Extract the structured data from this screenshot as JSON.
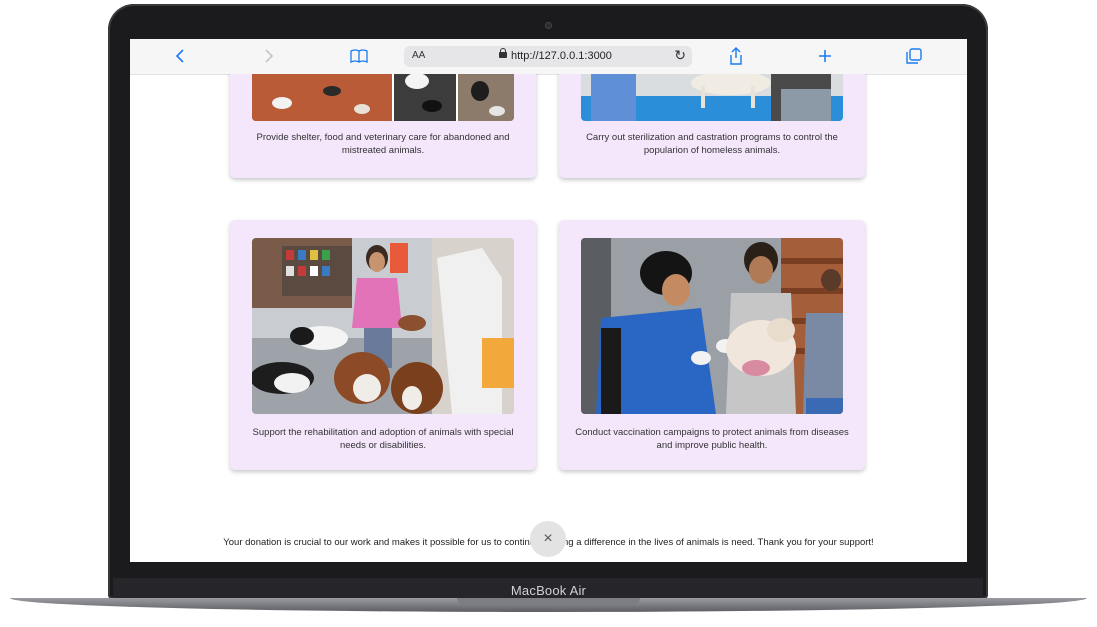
{
  "device": {
    "label": "MacBook Air"
  },
  "browser": {
    "text_size_label": "AA",
    "url": "http://127.0.0.1:3000",
    "icons": [
      "back-icon",
      "forward-icon",
      "reader-icon",
      "lock-icon",
      "reload-icon",
      "share-icon",
      "new-tab-icon",
      "tabs-icon"
    ]
  },
  "cards": [
    {
      "caption": "Provide shelter, food and veterinary care for abandoned and mistreated animals."
    },
    {
      "caption": "Carry out sterilization and castration programs to control the popularion of homeless animals."
    },
    {
      "caption": "Support the rehabilitation and adoption of animals with special needs or disabilities."
    },
    {
      "caption": "Conduct vaccination campaigns to protect animals from diseases and improve public health."
    }
  ],
  "footer_note": "Your donation is crucial to our work and makes it possible for us to continue making a difference in the lives of animals is need. Thank you for your support!",
  "close_symbol": "×",
  "colors": {
    "card_bg": "#f4e7fc",
    "accent": "#1a7bf2"
  }
}
